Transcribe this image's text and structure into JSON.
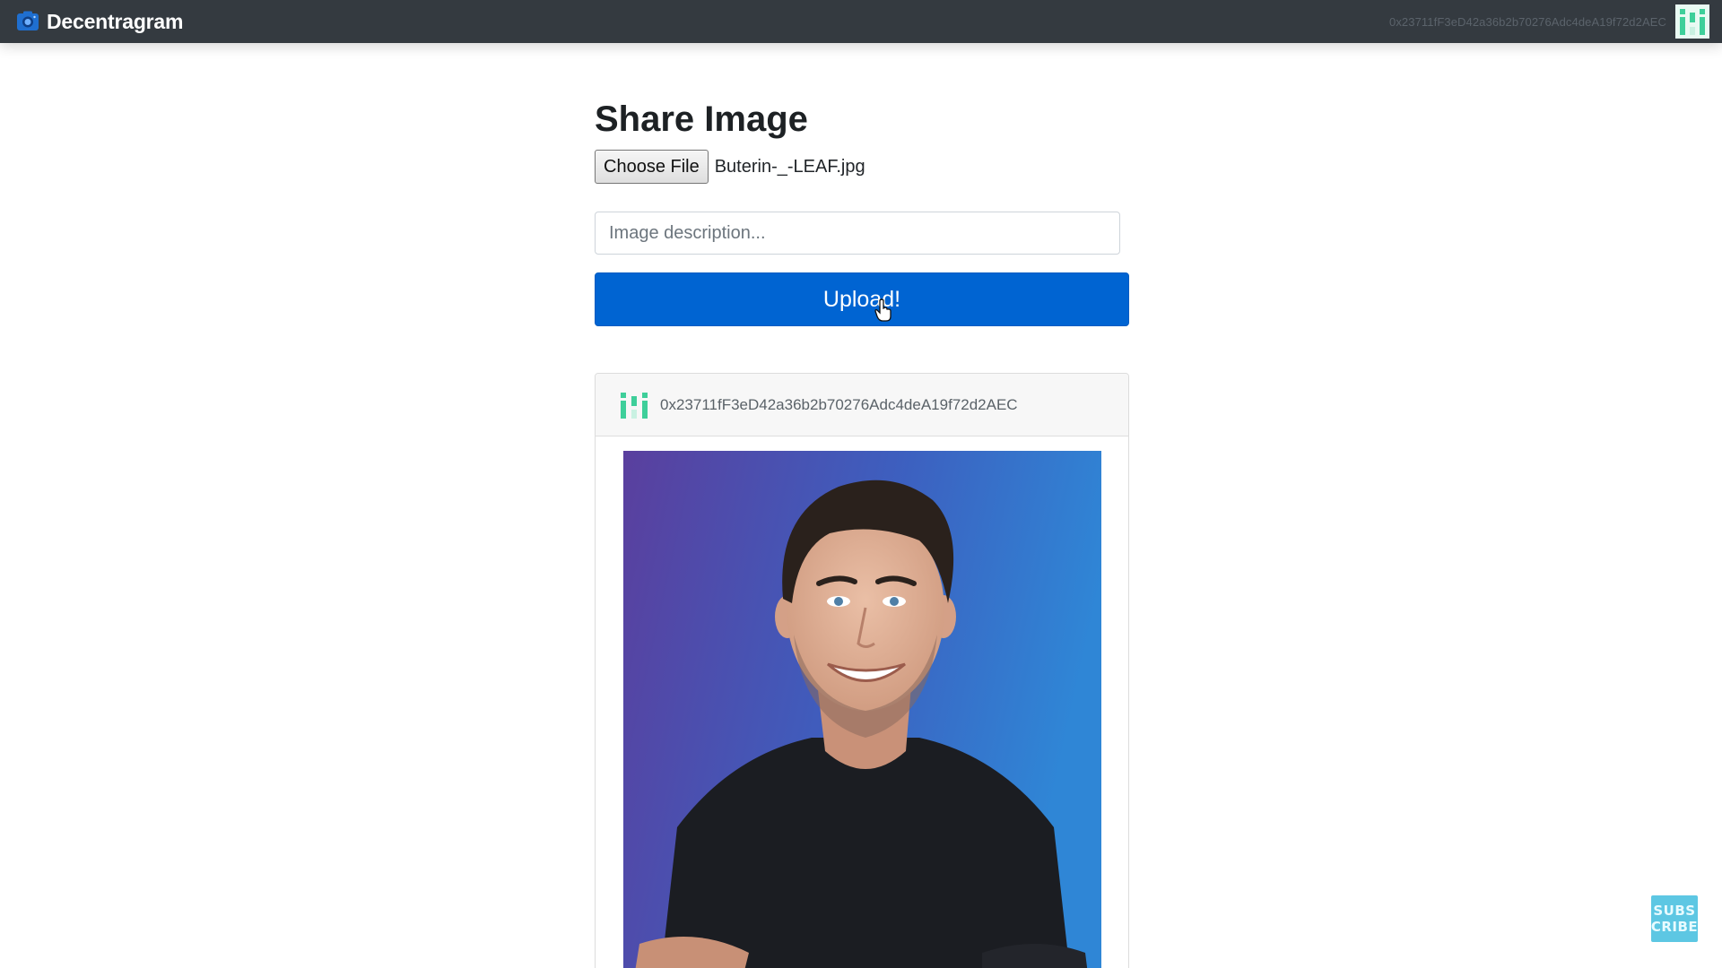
{
  "navbar": {
    "brand": "Decentragram",
    "account": "0x23711fF3eD42a36b2b70276Adc4deA19f72d2AEC",
    "brand_icon": "camera-icon",
    "avatar_icon": "identicon"
  },
  "share": {
    "title": "Share Image",
    "choose_file_label": "Choose File",
    "file_name": "Buterin-_-LEAF.jpg",
    "description_placeholder": "Image description...",
    "upload_label": "Upload!"
  },
  "post": {
    "author": "0x23711fF3eD42a36b2b70276Adc4deA19f72d2AEC",
    "avatar_icon": "identicon",
    "image": "portrait-photo"
  },
  "overlay": {
    "subscribe_line1": "SUBS",
    "subscribe_line2": "CRIBE"
  },
  "colors": {
    "navbar_bg": "#343a40",
    "primary": "#0064d2",
    "identicon": "#3ecf9a",
    "subscribe": "#5dc7e3"
  }
}
